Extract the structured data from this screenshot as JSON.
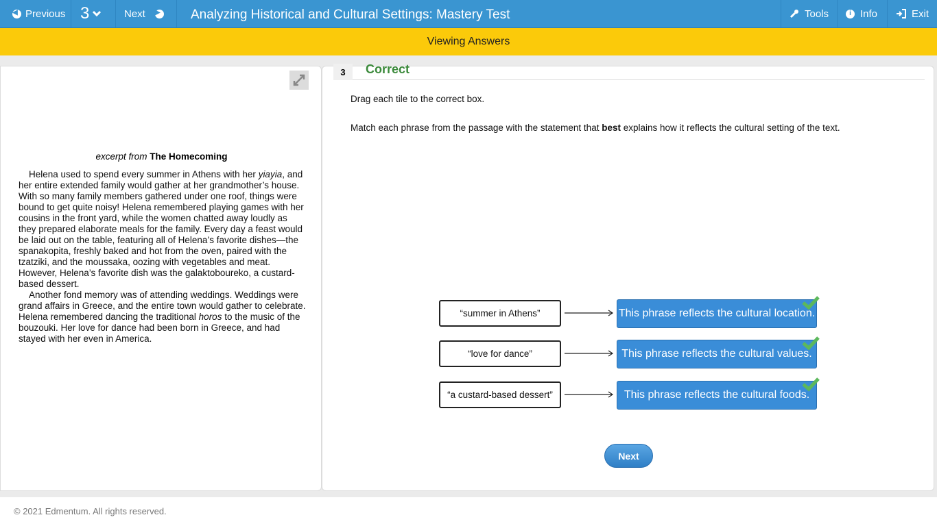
{
  "topbar": {
    "previous_label": "Previous",
    "question_number": "3",
    "next_label": "Next",
    "title": "Analyzing Historical and Cultural Settings: Mastery Test",
    "tools_label": "Tools",
    "info_label": "Info",
    "exit_label": "Exit"
  },
  "banner": {
    "text": "Viewing Answers"
  },
  "passage": {
    "excerpt_prefix": "excerpt from",
    "book_title": "The Homecoming",
    "p1_a": "Helena used to spend every summer in Athens with her ",
    "p1_italic": "yiayia",
    "p1_b": ", and her entire extended family would gather at her grandmother’s house. With so many family members gathered under one roof, things were bound to get quite noisy! Helena remembered playing games with her cousins in the front yard, while the women chatted away loudly as they prepared elaborate meals for the family. Every day a feast would be laid out on the table, featuring all of Helena’s favorite dishes—the spanakopita, freshly baked and hot from the oven, paired with the tzatziki, and the moussaka, oozing with vegetables and meat. However, Helena’s favorite dish was the galaktoboureko, a custard-based dessert.",
    "p2_a": "Another fond memory was of attending weddings. Weddings were grand affairs in Greece, and the entire town would gather to celebrate. Helena remembered dancing the traditional ",
    "p2_italic": "horos",
    "p2_b": " to the music of the bouzouki. Her love for dance had been born in Greece, and had stayed with her even in America."
  },
  "question": {
    "number": "3",
    "status": "Correct",
    "instruction": "Drag each tile to the correct box.",
    "prompt_a": "Match each phrase from the passage with the statement that ",
    "prompt_bold": "best",
    "prompt_b": " explains how it reflects the cultural setting of the text.",
    "pairs": [
      {
        "tile": "“summer in Athens”",
        "answer": "This phrase reflects the cultural location."
      },
      {
        "tile": "“love for dance”",
        "answer": "This phrase reflects the cultural values."
      },
      {
        "tile": "“a custard-based dessert”",
        "answer": "This phrase reflects the cultural foods."
      }
    ],
    "next_label": "Next"
  },
  "footer": {
    "copyright": "© 2021 Edmentum. All rights reserved."
  },
  "colors": {
    "topbar": "#3a95d1",
    "banner": "#fbca0a",
    "answer_box": "#3a8dd8",
    "correct": "#3b8a3b",
    "check": "#5cb85c"
  },
  "icons": [
    "arrow-left-icon",
    "chevron-down-icon",
    "arrow-right-icon",
    "wrench-icon",
    "info-icon",
    "exit-icon",
    "expand-icon",
    "check-icon"
  ]
}
